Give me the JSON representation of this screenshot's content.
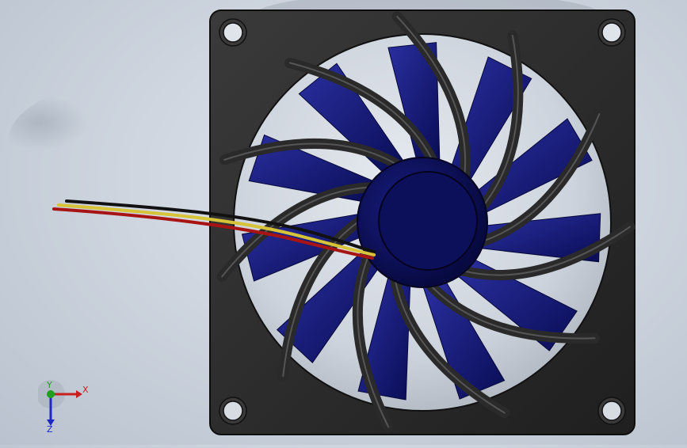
{
  "scene": {
    "background_color": "#d2d9e3",
    "fan_frame_color": "#2b2b2b",
    "blade_color": "#10147a",
    "hub_color": "#0d1060",
    "wire_colors": [
      "#111111",
      "#d9c43a",
      "#b01515"
    ]
  },
  "triad": {
    "x_label": "X",
    "y_label": "Y",
    "z_label": "Z",
    "x_color": "#c81e1e",
    "y_color": "#1ea01e",
    "z_color": "#1e28c8"
  }
}
